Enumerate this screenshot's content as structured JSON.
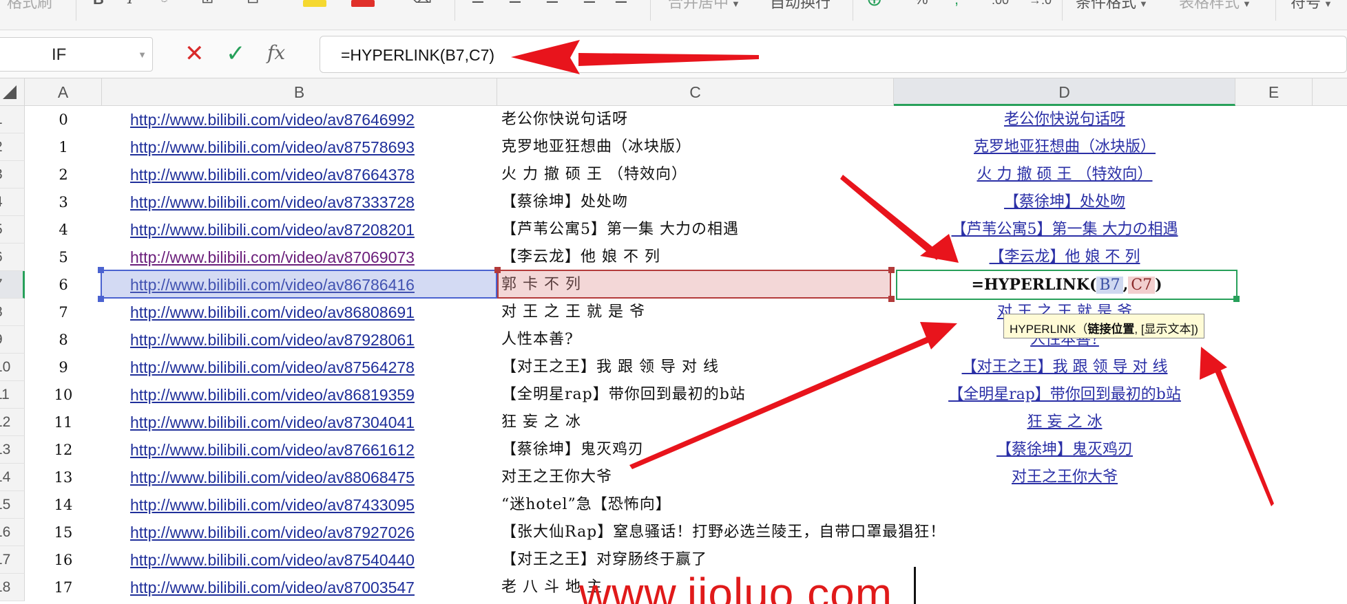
{
  "ribbon": {
    "items": [
      {
        "label": "格式刷",
        "faint": true
      },
      {
        "label": "B"
      },
      {
        "label": "I"
      },
      {
        "label": "合并居中",
        "faint": true,
        "caret": true
      },
      {
        "label": "自动换行"
      },
      {
        "label": "%"
      },
      {
        "label": ".00"
      },
      {
        "label": "→.0"
      },
      {
        "label": "条件格式",
        "caret": true
      },
      {
        "label": "表格样式",
        "faint": true,
        "caret": true
      },
      {
        "label": "符号",
        "caret": true
      }
    ],
    "colors": {
      "highlight": "#f5d830",
      "font_color": "#e0302a",
      "accent_green": "#27a05a"
    }
  },
  "formula_bar": {
    "name_box": "IF",
    "cancel_icon": "✕",
    "confirm_icon": "✓",
    "fx_label": "fx",
    "formula": "=HYPERLINK(B7,C7)"
  },
  "columns": [
    "A",
    "B",
    "C",
    "D",
    "E"
  ],
  "row_numbers": [
    "1",
    "2",
    "3",
    "4",
    "5",
    "6",
    "7",
    "8",
    "9",
    "10",
    "11",
    "12",
    "13",
    "14",
    "15",
    "16",
    "17",
    "18"
  ],
  "rows": [
    {
      "a": "0",
      "b": "http://www.bilibili.com/video/av87646992",
      "c": "老公你快说句话呀",
      "d": "老公你快说句话呀"
    },
    {
      "a": "1",
      "b": "http://www.bilibili.com/video/av87578693",
      "c": "克罗地亚狂想曲（冰块版）",
      "d": "克罗地亚狂想曲（冰块版）"
    },
    {
      "a": "2",
      "b": "http://www.bilibili.com/video/av87664378",
      "c": "火 力 撤 硕 王 （特效向）",
      "d": "火 力 撤 硕 王 （特效向）"
    },
    {
      "a": "3",
      "b": "http://www.bilibili.com/video/av87333728",
      "c": "【蔡徐坤】处处吻",
      "d": "【蔡徐坤】处处吻"
    },
    {
      "a": "4",
      "b": "http://www.bilibili.com/video/av87208201",
      "c": "【芦苇公寓5】第一集 大力の相遇",
      "d": "【芦苇公寓5】第一集 大力の相遇"
    },
    {
      "a": "5",
      "b": "http://www.bilibili.com/video/av87069073",
      "c": "【李云龙】他 娘 不 列",
      "d": "【李云龙】他 娘 不 列",
      "visited": true
    },
    {
      "a": "6",
      "b": "http://www.bilibili.com/video/av86786416",
      "c": "郭 卡 不 列",
      "d": ""
    },
    {
      "a": "7",
      "b": "http://www.bilibili.com/video/av86808691",
      "c": "对 王 之 王 就 是 爷",
      "d": "对 王 之 王 就 是 爷"
    },
    {
      "a": "8",
      "b": "http://www.bilibili.com/video/av87928061",
      "c": "人性本善?",
      "d": "人性本善?"
    },
    {
      "a": "9",
      "b": "http://www.bilibili.com/video/av87564278",
      "c": "【对王之王】我 跟 领 导 对 线",
      "d": "【对王之王】我 跟 领 导 对 线"
    },
    {
      "a": "10",
      "b": "http://www.bilibili.com/video/av86819359",
      "c": "【全明星rap】带你回到最初的b站",
      "d": "【全明星rap】带你回到最初的b站"
    },
    {
      "a": "11",
      "b": "http://www.bilibili.com/video/av87304041",
      "c": "狂 妄 之 冰",
      "d": "狂 妄 之 冰"
    },
    {
      "a": "12",
      "b": "http://www.bilibili.com/video/av87661612",
      "c": "【蔡徐坤】鬼灭鸡刃",
      "d": "【蔡徐坤】鬼灭鸡刃"
    },
    {
      "a": "13",
      "b": "http://www.bilibili.com/video/av88068475",
      "c": "对王之王你大爷",
      "d": "对王之王你大爷"
    },
    {
      "a": "14",
      "b": "http://www.bilibili.com/video/av87433095",
      "c": "“迷hotel”急【恐怖向】",
      "d": ""
    },
    {
      "a": "15",
      "b": "http://www.bilibili.com/video/av87927026",
      "c": "【张大仙Rap】窒息骚话！打野必选兰陵王，自带口罩最猖狂！",
      "d": ""
    },
    {
      "a": "16",
      "b": "http://www.bilibili.com/video/av87540440",
      "c": "【对王之王】对穿肠终于赢了",
      "d": ""
    },
    {
      "a": "17",
      "b": "http://www.bilibili.com/video/av87003547",
      "c": "老 八 斗 地 主",
      "d": ""
    }
  ],
  "active_cell": {
    "prefix": "=HYPERLINK(",
    "ref1": "B7",
    "comma": ",",
    "ref2": "C7",
    "suffix": ")"
  },
  "tooltip": {
    "func": "HYPERLINK",
    "open": "（",
    "arg1": "链接位置",
    "rest": ", [显示文本])"
  },
  "watermark": "www.jioluo.com"
}
